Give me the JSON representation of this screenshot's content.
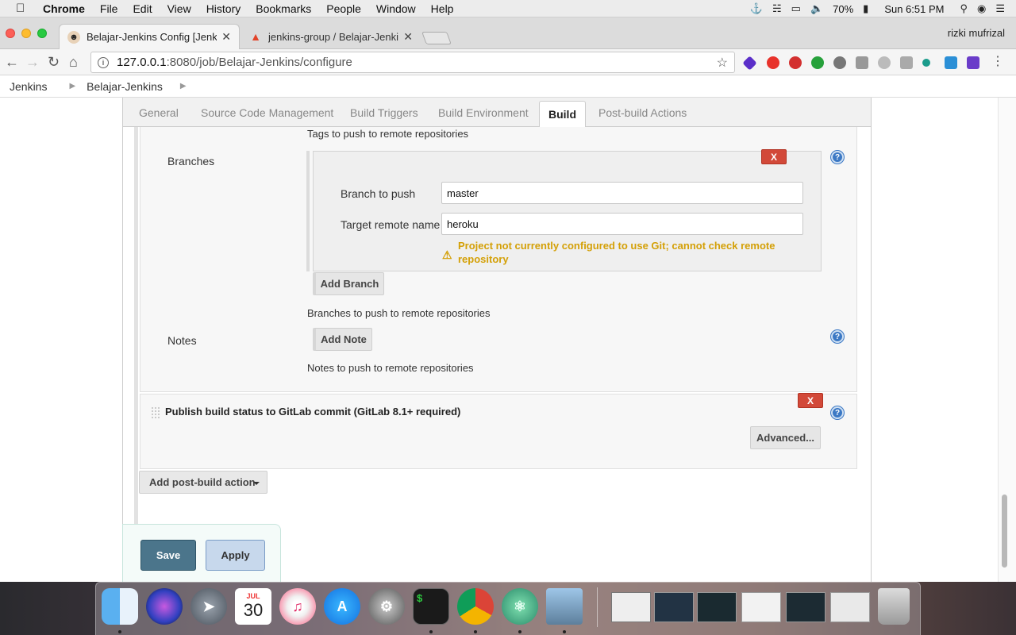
{
  "menubar": {
    "app": "Chrome",
    "items": [
      "File",
      "Edit",
      "View",
      "History",
      "Bookmarks",
      "People",
      "Window",
      "Help"
    ],
    "battery": "70%",
    "clock": "Sun 6:51 PM"
  },
  "browser": {
    "tabs": [
      {
        "title": "Belajar-Jenkins Config [Jenkins]"
      },
      {
        "title": "jenkins-group / Belajar-Jenkins"
      }
    ],
    "profile": "rizki mufrizal",
    "url_host": "127.0.0.1",
    "url_path": ":8080/job/Belajar-Jenkins/configure"
  },
  "breadcrumb": {
    "root": "Jenkins",
    "job": "Belajar-Jenkins"
  },
  "config_tabs": [
    "General",
    "Source Code Management",
    "Build Triggers",
    "Build Environment",
    "Build",
    "Post-build Actions"
  ],
  "active_tab": "Build",
  "git_publisher": {
    "tags_help": "Tags to push to remote repositories",
    "branches_label": "Branches",
    "branch_to_push_label": "Branch to push",
    "branch_to_push_value": "master",
    "target_remote_label": "Target remote name",
    "target_remote_value": "heroku",
    "warning": "Project not currently configured to use Git; cannot check remote repository",
    "add_branch": "Add Branch",
    "branches_help": "Branches to push to remote repositories",
    "notes_label": "Notes",
    "add_note": "Add Note",
    "notes_help": "Notes to push to remote repositories",
    "delete_label": "X",
    "help_label": "?"
  },
  "gitlab_publisher": {
    "title": "Publish build status to GitLab commit (GitLab 8.1+ required)",
    "advanced": "Advanced...",
    "delete_label": "X"
  },
  "add_post_build_action": "Add post-build action",
  "save": "Save",
  "apply": "Apply",
  "dock": {
    "calendar_month": "JUL",
    "calendar_day": "30"
  }
}
